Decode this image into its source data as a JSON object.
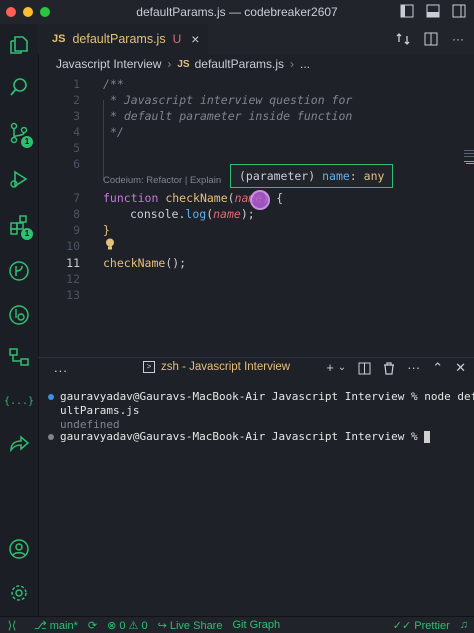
{
  "window": {
    "title": "defaultParams.js — codebreaker2607",
    "colors": {
      "close": "#ff5f57",
      "minimize": "#febc2e",
      "maximize": "#28c840",
      "accent": "#2fbf71"
    }
  },
  "activity_bar": {
    "items": [
      {
        "name": "explorer-icon",
        "badge": ""
      },
      {
        "name": "search-icon",
        "badge": ""
      },
      {
        "name": "source-control-icon",
        "badge": "1"
      },
      {
        "name": "run-debug-icon",
        "badge": ""
      },
      {
        "name": "extensions-icon",
        "badge": "1"
      },
      {
        "name": "git-graph-icon",
        "badge": ""
      },
      {
        "name": "remote-icon",
        "badge": ""
      },
      {
        "name": "testing-icon",
        "badge": ""
      },
      {
        "name": "json-icon",
        "badge": "{...}"
      },
      {
        "name": "live-share-icon",
        "badge": ""
      }
    ],
    "bottom": [
      "account-icon",
      "settings-gear-icon"
    ]
  },
  "tab": {
    "lang": "JS",
    "label": "defaultParams.js",
    "status": "U",
    "close": "×"
  },
  "breadcrumb": {
    "folder": "Javascript Interview",
    "lang": "JS",
    "file": "defaultParams.js",
    "more": "..."
  },
  "editor": {
    "line_numbers": [
      "1",
      "2",
      "3",
      "4",
      "5",
      "6",
      "7",
      "8",
      "9",
      "10",
      "11",
      "12",
      "13"
    ],
    "active_line": "11",
    "lines": {
      "l1": "/**",
      "l2": "* Javascript interview question for",
      "l3": "* default parameter inside function",
      "l4": "*/",
      "l7_kw": "function",
      "l7_fn": "checkName",
      "l7_open": "(",
      "l7_param": "name",
      "l7_close": ") {",
      "l8_obj": "console",
      "l8_dot": ".",
      "l8_fn": "log",
      "l8_open": "(",
      "l8_arg": "name",
      "l8_close": ");",
      "l9": "}",
      "l11_fn": "checkName",
      "l11_rest": "();"
    },
    "codelens": "Codeium: Refactor | Explain",
    "hover": {
      "part1": "(parameter) ",
      "part2": "name",
      "part3": ": any"
    }
  },
  "panel": {
    "dots": "...",
    "terminal_tab": "zsh - Javascript Interview",
    "terminal_tab_icon": ">"
  },
  "terminal": {
    "line1": "gauravyadav@Gauravs-MacBook-Air Javascript Interview % node defa",
    "line2": "ultParams.js",
    "line3": "undefined",
    "line4": "gauravyadav@Gauravs-MacBook-Air Javascript Interview % "
  },
  "statusbar": {
    "branch": "main*",
    "errors": "0",
    "warnings": "0",
    "live_share": "Live Share",
    "git_graph": "Git Graph",
    "prettier": "Prettier"
  }
}
